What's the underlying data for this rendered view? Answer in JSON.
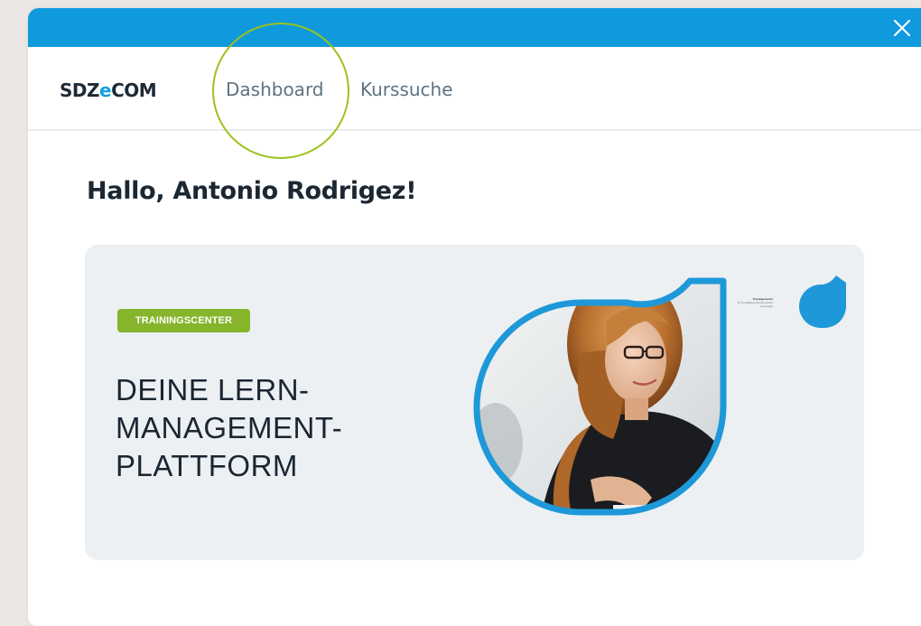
{
  "brand": {
    "prefix": "SDZ",
    "accent_letter": "e",
    "suffix": "COM",
    "accent_color": "#10a1df"
  },
  "topbar": {
    "color": "#0f9ade",
    "close_icon": "close-icon"
  },
  "nav": {
    "items": [
      {
        "label": "Dashboard",
        "highlighted": true
      },
      {
        "label": "Kurssuche",
        "highlighted": false
      }
    ],
    "highlight_color": "#9bc21c"
  },
  "greeting": "Hallo, Antonio Rodrigez!",
  "banner": {
    "badge": "TRAININGSCENTER",
    "badge_color": "#86b52b",
    "headline_lines": [
      "DEINE LERN-",
      "MANAGEMENT-",
      "PLATTFORM"
    ],
    "frame_color": "#1e98d8",
    "tiny_text": [
      "Trainingscenter",
      "Ihr Produktbeschreibung kurz",
      "und knapp"
    ]
  }
}
